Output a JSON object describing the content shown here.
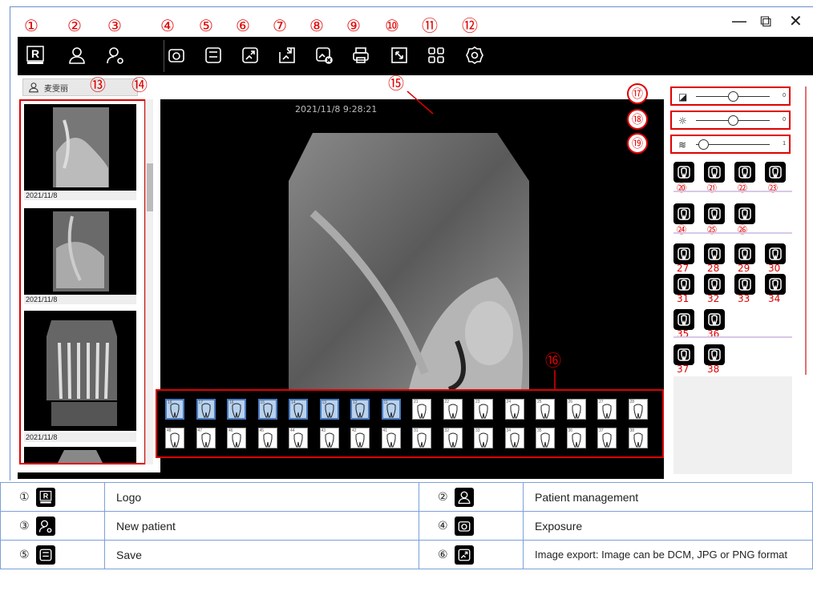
{
  "window": {
    "minimize_glyph": "—",
    "restore_glyph": "⧉",
    "close_glyph": "✕"
  },
  "toolbar": {
    "items": [
      {
        "num": "①",
        "icon": "refine-logo-icon"
      },
      {
        "num": "②",
        "icon": "patient-management-icon"
      },
      {
        "num": "③",
        "icon": "new-patient-icon"
      },
      {
        "num": "④",
        "icon": "camera-icon"
      },
      {
        "num": "⑤",
        "icon": "save-icon"
      },
      {
        "num": "⑥",
        "icon": "image-export-icon"
      },
      {
        "num": "⑦",
        "icon": "image-import-icon"
      },
      {
        "num": "⑧",
        "icon": "image-delete-icon"
      },
      {
        "num": "⑨",
        "icon": "print-icon"
      },
      {
        "num": "⑩",
        "icon": "fullscreen-icon"
      },
      {
        "num": "⑪",
        "icon": "layout-grid-icon"
      },
      {
        "num": "⑫",
        "icon": "settings-icon"
      }
    ]
  },
  "patient": {
    "name": "麦雯丽",
    "num": "⑬"
  },
  "thumbnails": {
    "num": "⑭",
    "dates": [
      "2021/11/8",
      "2021/11/8",
      "2021/11/8"
    ]
  },
  "viewer": {
    "num": "⑮",
    "timestamp": "2021/11/8 9:28:21"
  },
  "toothchart": {
    "num": "⑯",
    "upper": [
      "18",
      "17",
      "16",
      "15",
      "14",
      "13",
      "12",
      "11",
      "21",
      "22",
      "23",
      "24",
      "25",
      "26",
      "27",
      "28"
    ],
    "lower": [
      "48",
      "47",
      "46",
      "45",
      "44",
      "43",
      "42",
      "41",
      "31",
      "32",
      "33",
      "34",
      "35",
      "36",
      "37",
      "38"
    ],
    "selected_upper_count": 8
  },
  "sliders": [
    {
      "num": "⑰",
      "icon": "contrast-icon",
      "value": "0",
      "position": 0.5
    },
    {
      "num": "⑱",
      "icon": "brightness-icon",
      "value": "0",
      "position": 0.5
    },
    {
      "num": "⑲",
      "icon": "sharpness-icon",
      "value": "1",
      "position": 0.1
    }
  ],
  "tools": {
    "row1": [
      "⑳",
      "㉑",
      "㉒",
      "㉓"
    ],
    "row2": [
      "㉔",
      "㉕",
      "㉖"
    ],
    "row3": [
      "27",
      "28",
      "29",
      "30"
    ],
    "row4": [
      "31",
      "32",
      "33",
      "34"
    ],
    "row5": [
      "35",
      "36"
    ],
    "row6": [
      "37",
      "38"
    ]
  },
  "legend": [
    {
      "left_num": "①",
      "left_desc": "Logo",
      "right_num": "②",
      "right_desc": "Patient management"
    },
    {
      "left_num": "③",
      "left_desc": "New patient",
      "right_num": "④",
      "right_desc": "Exposure"
    },
    {
      "left_num": "⑤",
      "left_desc": "Save",
      "right_num": "⑥",
      "right_desc": "Image export: Image can be DCM, JPG or PNG format"
    }
  ],
  "colors": {
    "callout": "#e00000",
    "toolbar_bg": "#000000",
    "legend_border": "#7ca0d8"
  }
}
